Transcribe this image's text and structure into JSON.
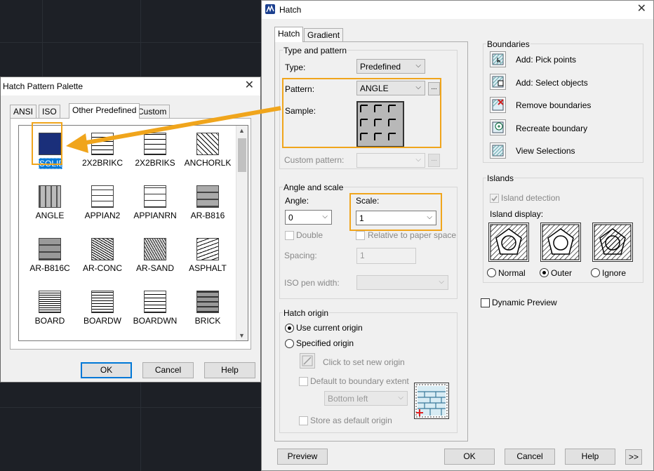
{
  "hatch_dialog": {
    "title": "Hatch",
    "close_glyph": "✕",
    "tabs": [
      "Hatch",
      "Gradient"
    ],
    "type_and_pattern": {
      "group_label": "Type and pattern",
      "type_label": "Type:",
      "type_value": "Predefined",
      "pattern_label": "Pattern:",
      "pattern_value": "ANGLE",
      "ellipsis": "...",
      "sample_label": "Sample:",
      "custom_pattern_label": "Custom pattern:",
      "custom_pattern_value": ""
    },
    "angle_and_scale": {
      "group_label": "Angle and scale",
      "angle_label": "Angle:",
      "angle_value": "0",
      "scale_label": "Scale:",
      "scale_value": "1",
      "double_label": "Double",
      "relative_label": "Relative to paper space",
      "spacing_label": "Spacing:",
      "spacing_value": "1",
      "iso_pen_label": "ISO pen width:",
      "iso_pen_value": ""
    },
    "hatch_origin": {
      "group_label": "Hatch origin",
      "use_current_label": "Use current origin",
      "specified_label": "Specified origin",
      "click_set_label": "Click to set new origin",
      "default_boundary_label": "Default to boundary extent",
      "position_value": "Bottom left",
      "store_default_label": "Store as default origin"
    },
    "boundaries": {
      "group_label": "Boundaries",
      "items": [
        "Add: Pick points",
        "Add: Select objects",
        "Remove boundaries",
        "Recreate boundary",
        "View Selections"
      ]
    },
    "islands": {
      "group_label": "Islands",
      "island_detection_label": "Island detection",
      "island_display_label": "Island display:",
      "styles": [
        "Normal",
        "Outer",
        "Ignore"
      ],
      "selected_style": "Outer"
    },
    "dynamic_preview_label": "Dynamic Preview",
    "buttons": {
      "preview": "Preview",
      "ok": "OK",
      "cancel": "Cancel",
      "help": "Help",
      "expand": ">>"
    }
  },
  "palette": {
    "title": "Hatch Pattern Palette",
    "close_glyph": "✕",
    "tabs": [
      "ANSI",
      "ISO",
      "Other Predefined",
      "Custom"
    ],
    "active_tab": "Other Predefined",
    "patterns": [
      "SOLID",
      "2X2BRIKC",
      "2X2BRIKS",
      "ANCHORLK",
      "ANGLE",
      "APPIAN2",
      "APPIANRN",
      "AR-B816",
      "AR-B816C",
      "AR-CONC",
      "AR-SAND",
      "ASPHALT",
      "BOARD",
      "BOARDW",
      "BOARDWN",
      "BRICK"
    ],
    "selected_pattern": "SOLID",
    "buttons": {
      "ok": "OK",
      "cancel": "Cancel",
      "help": "Help"
    }
  },
  "colors": {
    "highlight": "#f0a51c",
    "accent": "#0078d7",
    "solid_fill": "#1a2f7a",
    "background": "#1d2026"
  }
}
